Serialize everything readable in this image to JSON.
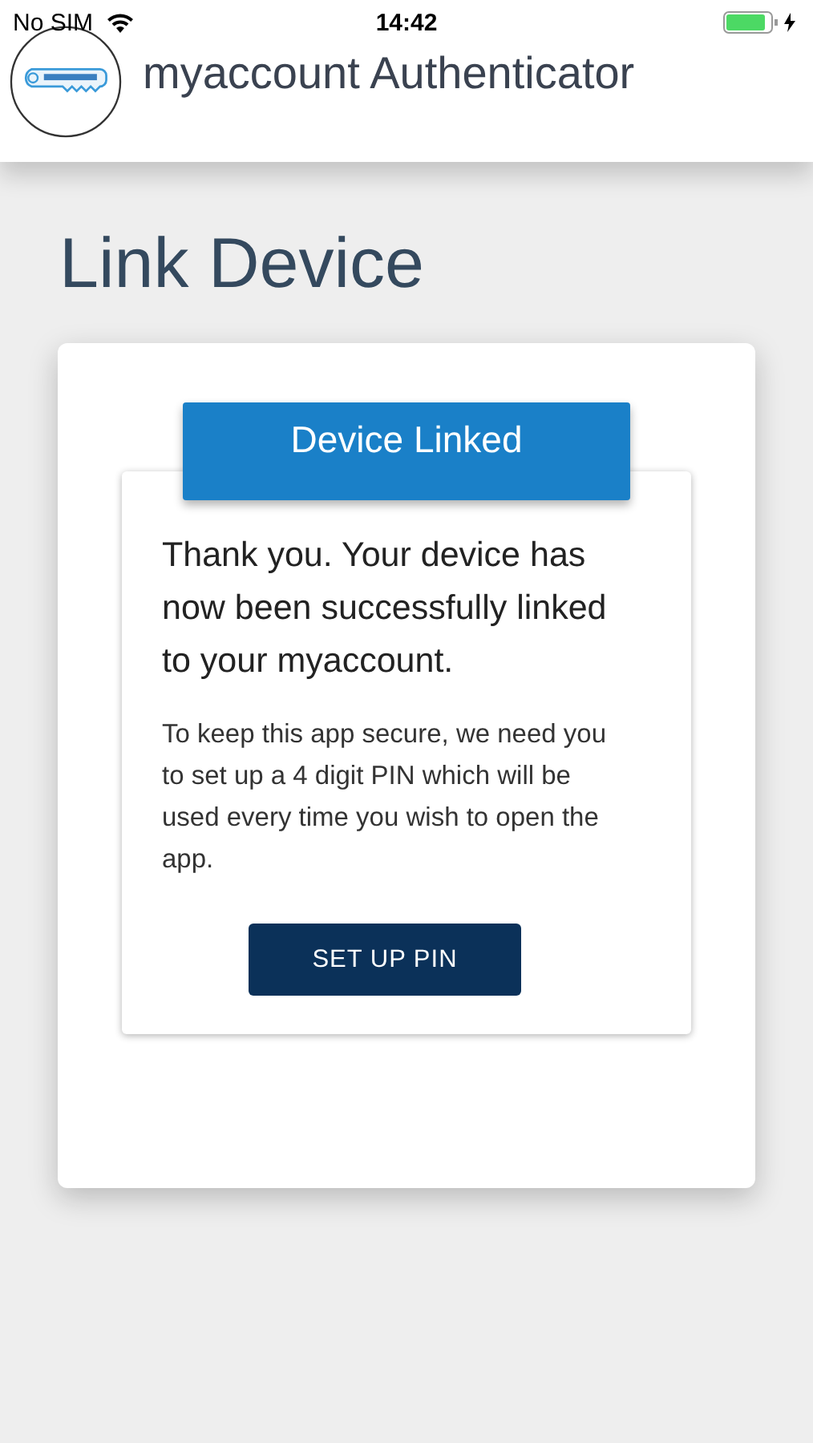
{
  "status_bar": {
    "carrier": "No SIM",
    "time": "14:42"
  },
  "header": {
    "title": "myaccount Authenticator"
  },
  "page_title": "Link Device",
  "banner": "Device Linked",
  "message": "Thank you. Your device has now been successfully linked to your myaccount.",
  "detail": "To keep this app secure, we need you to set up a 4 digit PIN which will be used every time you wish to open the app.",
  "button": "SET UP PIN"
}
